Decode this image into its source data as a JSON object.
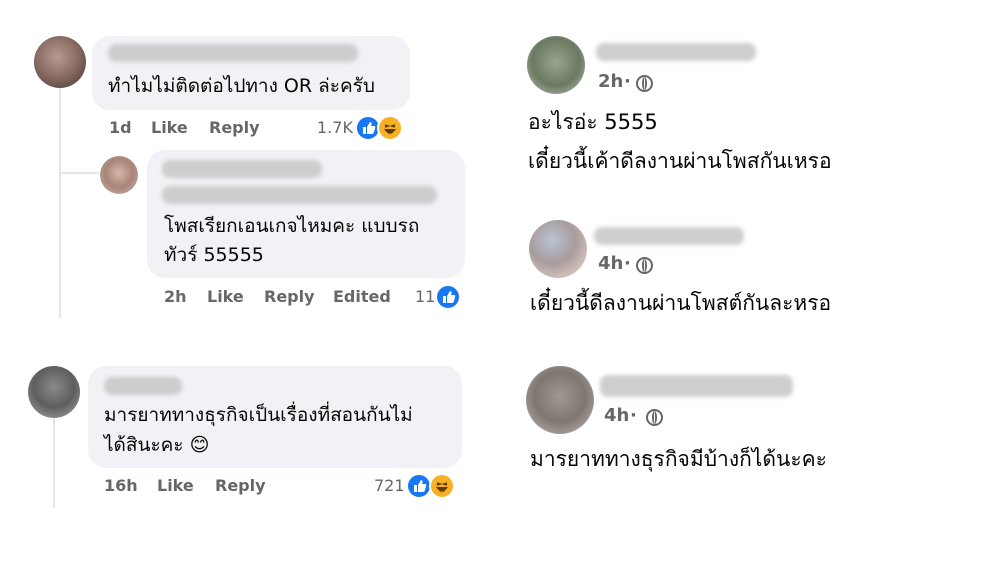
{
  "left_thread": {
    "comment1": {
      "text": "ทำไมไม่ติดต่อไปทาง OR ล่ะครับ",
      "time": "1d",
      "like_label": "Like",
      "reply_label": "Reply",
      "reaction_count": "1.7K",
      "reactions": [
        "like-icon",
        "haha-icon"
      ]
    },
    "reply1": {
      "text_line1": "โพสเรียกเอนเกจไหมคะ แบบรถ",
      "text_line2": "ทัวร์ 55555",
      "time": "2h",
      "like_label": "Like",
      "reply_label": "Reply",
      "edited_label": "Edited",
      "reaction_count": "11",
      "reactions": [
        "like-icon"
      ]
    },
    "comment2": {
      "text_line1": "มารยาททางธุรกิจเป็นเรื่องที่สอนกันไม่",
      "text_line2": "ได้สินะคะ 😊",
      "time": "16h",
      "like_label": "Like",
      "reply_label": "Reply",
      "reaction_count": "721",
      "reactions": [
        "like-icon",
        "haha-icon"
      ]
    }
  },
  "right_comments": [
    {
      "time": "2h",
      "separator": "·",
      "line1": "อะไรอ่ะ 5555",
      "line2": "เดี๋ยวนี้เค้าดีลงานผ่านโพสกันเหรอ"
    },
    {
      "time": "4h",
      "separator": "·",
      "line1": "เดี๋ยวนี้ดีลงานผ่านโพสต์กันละหรอ"
    },
    {
      "time": "4h",
      "separator": "·",
      "line1": "มารยาททางธุรกิจมีบ้างก็ได้นะคะ"
    }
  ],
  "colors": {
    "bubble": "#f0f2f5",
    "meta_text": "#65676b",
    "like_blue": "#1877f2",
    "haha_yellow": "#f7b125"
  }
}
